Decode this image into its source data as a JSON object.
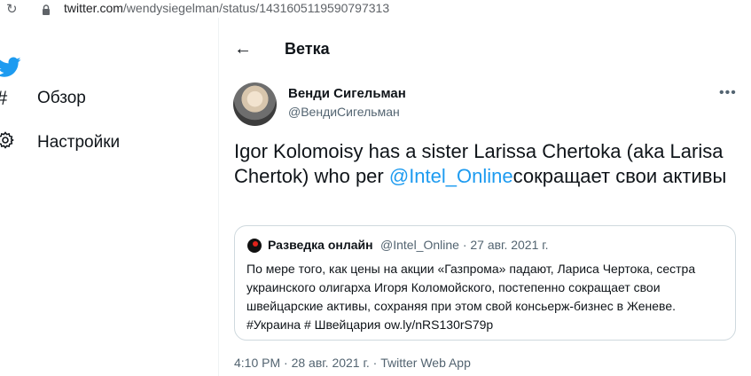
{
  "browser": {
    "url_host": "twitter.com",
    "url_path": "/wendysiegelman/status/1431605119590797313"
  },
  "nav": {
    "items": [
      {
        "label": "Обзор",
        "icon": "hash-icon"
      },
      {
        "label": "Настройки",
        "icon": "gear-icon"
      }
    ]
  },
  "header": {
    "title": "Ветка"
  },
  "tweet": {
    "author_name": "Венди Сигельман",
    "author_handle": "@ВендиСигельман",
    "text_before": "Igor Kolomoisy has a sister Larissa Chertoka (aka Larisa Chertok) who per ",
    "mention": "@Intel_Online",
    "text_after": "сокращает свои активы",
    "timestamp": "4:10 PM · 28 авг. 2021 г. · Twitter Web App"
  },
  "quote": {
    "name": "Разведка онлайн",
    "meta": "@Intel_Online · 27 авг. 2021 г.",
    "text": "По мере того, как цены на акции «Газпрома» падают, Лариса Чертока, сестра украинского олигарха Игоря Коломойского, постепенно сокращает свои швейцарские активы, сохраняя при этом свой консьерж-бизнес в Женеве. #Украина # Швейцария ow.ly/nRS130rS79p"
  },
  "colors": {
    "accent": "#1d9bf0",
    "text": "#0f1419",
    "secondary": "#536471",
    "border": "#cfd9de"
  }
}
